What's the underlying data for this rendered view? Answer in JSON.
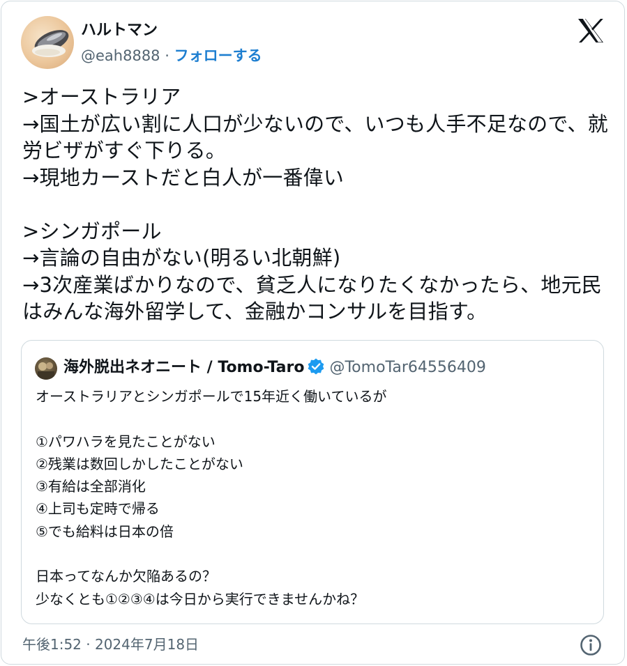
{
  "author": {
    "display_name": "ハルトマン",
    "handle": "@eah8888",
    "separator": "·",
    "follow_label": "フォローする"
  },
  "tweet": {
    "text": ">オーストラリア\n→国土が広い割に人口が少ないので、いつも人手不足なので、就労ビザがすぐ下りる。\n→現地カーストだと白人が一番偉い\n\n>シンガポール\n→言論の自由がない(明るい北朝鮮)\n→3次産業ばかりなので、貧乏人になりたくなかったら、地元民はみんな海外留学して、金融かコンサルを目指す。"
  },
  "quoted_tweet": {
    "display_name": "海外脱出ネオニート / Tomo-Taro",
    "handle": "@TomoTar64556409",
    "text": "オーストラリアとシンガポールで15年近く働いているが\n\n①パワハラを見たことがない\n②残業は数回しかしたことがない\n③有給は全部消化\n④上司も定時で帰る\n⑤でも給料は日本の倍\n\n日本ってなんか欠陥あるの？\n少なくとも①②③④は今日から実行できませんかね？"
  },
  "timestamp": "午後1:52 · 2024年7月18日",
  "colors": {
    "accent": "#1d9bf0",
    "follow": "#1d7ed0",
    "muted": "#536471",
    "border": "#cfd9de",
    "text": "#0f1419"
  },
  "icons": {
    "brand": "x-logo-icon",
    "verified": "verified-badge-icon",
    "info": "info-icon"
  }
}
